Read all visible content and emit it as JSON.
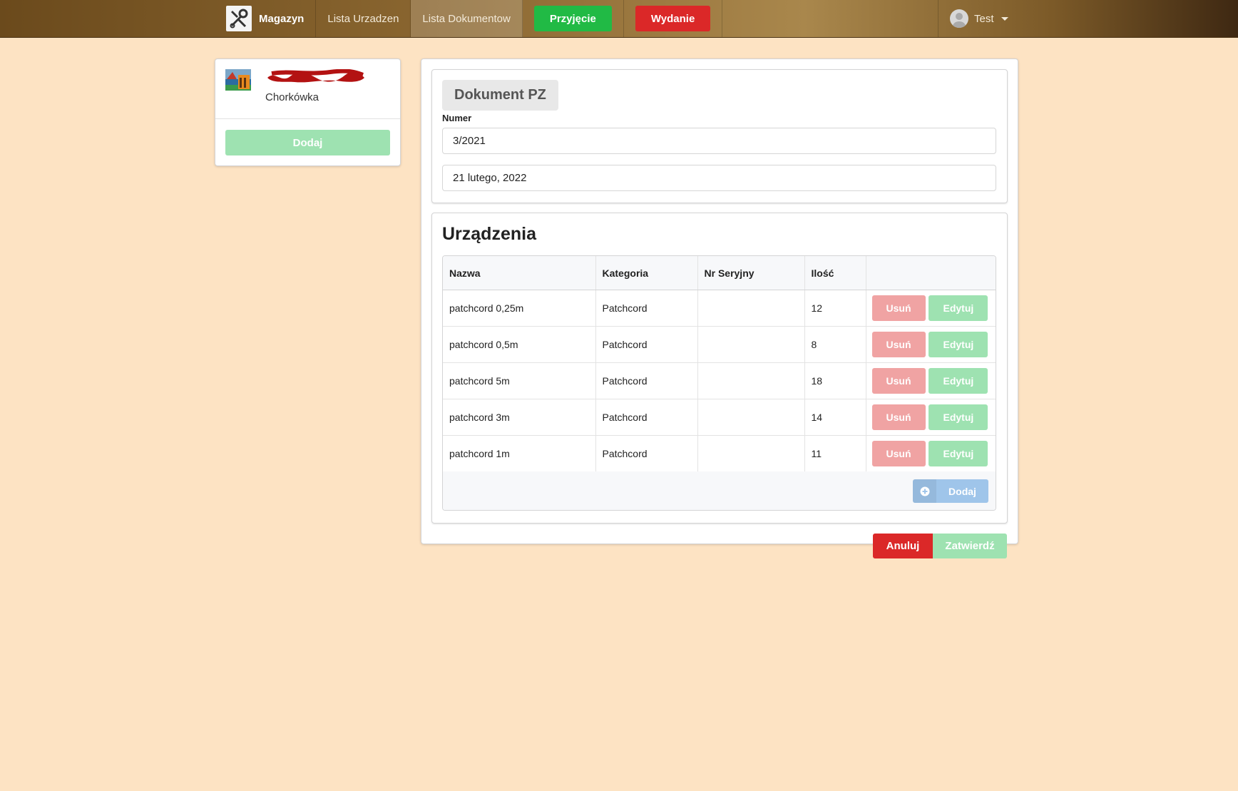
{
  "nav": {
    "brand": "Magazyn",
    "brand_icon": "tools-icon",
    "links": [
      {
        "label": "Lista Urzadzen",
        "active": false
      },
      {
        "label": "Lista Dokumentow",
        "active": true
      }
    ],
    "btn_receive": "Przyjęcie",
    "btn_issue": "Wydanie",
    "user": "Test"
  },
  "sidebar": {
    "city": "Chorkówka",
    "add_label": "Dodaj"
  },
  "document": {
    "label": "Dokument PZ",
    "number_label": "Numer",
    "number_value": "3/2021",
    "date_value": "21 lutego, 2022"
  },
  "devices": {
    "title": "Urządzenia",
    "columns": [
      "Nazwa",
      "Kategoria",
      "Nr Seryjny",
      "Ilość",
      ""
    ],
    "rows": [
      {
        "name": "patchcord 0,25m",
        "category": "Patchcord",
        "serial": "",
        "qty": "12"
      },
      {
        "name": "patchcord 0,5m",
        "category": "Patchcord",
        "serial": "",
        "qty": "8"
      },
      {
        "name": "patchcord 5m",
        "category": "Patchcord",
        "serial": "",
        "qty": "18"
      },
      {
        "name": "patchcord 3m",
        "category": "Patchcord",
        "serial": "",
        "qty": "14"
      },
      {
        "name": "patchcord 1m",
        "category": "Patchcord",
        "serial": "",
        "qty": "11"
      }
    ],
    "delete_label": "Usuń",
    "edit_label": "Edytuj",
    "add_label": "Dodaj"
  },
  "footer": {
    "cancel_label": "Anuluj",
    "confirm_label": "Zatwierdź"
  },
  "colors": {
    "background": "#fde3c3",
    "green": "#21ba45",
    "red": "#db2828",
    "green_disabled": "#9ee2b1",
    "red_disabled": "#f0a3a3",
    "blue_disabled": "#9fc5ea"
  }
}
